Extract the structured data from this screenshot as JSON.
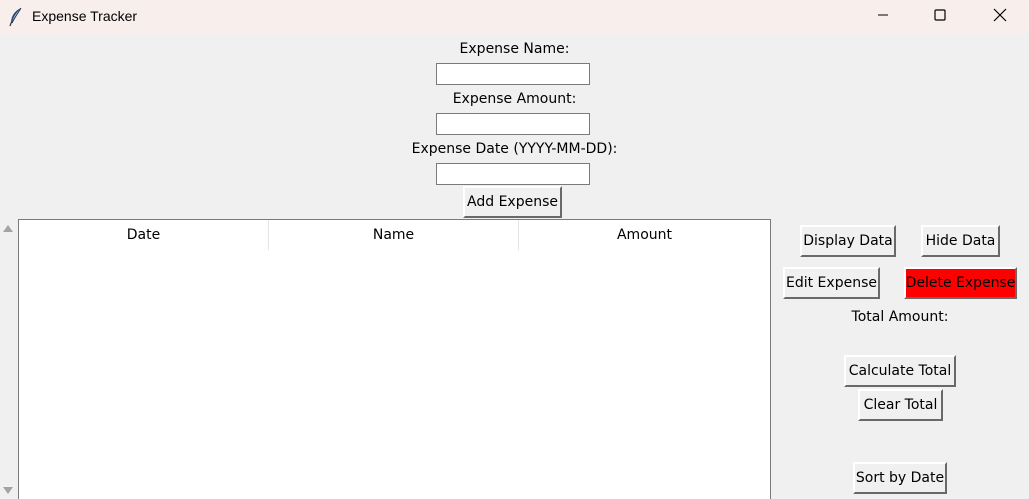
{
  "window": {
    "title": "Expense Tracker"
  },
  "form": {
    "name_label": "Expense Name:",
    "amount_label": "Expense Amount:",
    "date_label": "Expense Date (YYYY-MM-DD):",
    "name_value": "",
    "amount_value": "",
    "date_value": "",
    "add_button": "Add Expense"
  },
  "table": {
    "columns": [
      "Date",
      "Name",
      "Amount"
    ],
    "rows": []
  },
  "actions": {
    "display_data": "Display Data",
    "hide_data": "Hide Data",
    "edit_expense": "Edit Expense",
    "delete_expense": "Delete Expense",
    "total_label": "Total Amount:",
    "calculate_total": "Calculate Total",
    "clear_total": "Clear Total",
    "sort_by_date": "Sort by Date"
  },
  "colors": {
    "delete_button_bg": "#ff0000",
    "titlebar_bg": "#f8efed",
    "window_bg": "#f0f0f0"
  },
  "icons": {
    "app": "feather-icon",
    "minimize": "minimize-icon",
    "maximize": "maximize-icon",
    "close": "close-icon"
  }
}
